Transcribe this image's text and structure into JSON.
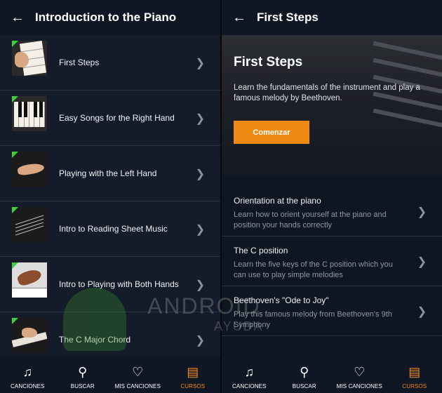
{
  "left": {
    "header": {
      "back_icon": "arrow-left-icon",
      "title": "Introduction to the Piano"
    },
    "items": [
      {
        "label": "First Steps"
      },
      {
        "label": "Easy Songs for the Right Hand"
      },
      {
        "label": "Playing with the Left Hand"
      },
      {
        "label": "Intro to Reading Sheet Music"
      },
      {
        "label": "Intro to Playing with Both Hands"
      },
      {
        "label": "The C Major Chord"
      }
    ]
  },
  "right": {
    "header": {
      "back_icon": "arrow-left-icon",
      "title": "First Steps"
    },
    "hero": {
      "title": "First Steps",
      "description": "Learn the fundamentals of the instrument and play a famous melody by Beethoven.",
      "cta": "Comenzar"
    },
    "lessons": [
      {
        "title": "Orientation at the piano",
        "description": "Learn how to orient yourself at the piano and position your hands correctly"
      },
      {
        "title": "The C position",
        "description": "Learn the five keys of the C position which you can use to play simple melodies"
      },
      {
        "title": "Beethoven's \"Ode to Joy\"",
        "description": "Play this famous melody from Beethoven's 9th Symphony"
      }
    ]
  },
  "nav": {
    "items": [
      {
        "label": "CANCIONES",
        "icon": "music-note-icon"
      },
      {
        "label": "BUSCAR",
        "icon": "search-icon"
      },
      {
        "label": "MIS CANCIONES",
        "icon": "heart-icon"
      },
      {
        "label": "CURSOS",
        "icon": "courses-icon"
      }
    ],
    "active": "CURSOS"
  },
  "watermark": {
    "line1": "ANDROID",
    "line2": "AYUDA"
  },
  "colors": {
    "accent": "#f08a12",
    "new_badge": "#39d23b",
    "background": "#141b29"
  }
}
